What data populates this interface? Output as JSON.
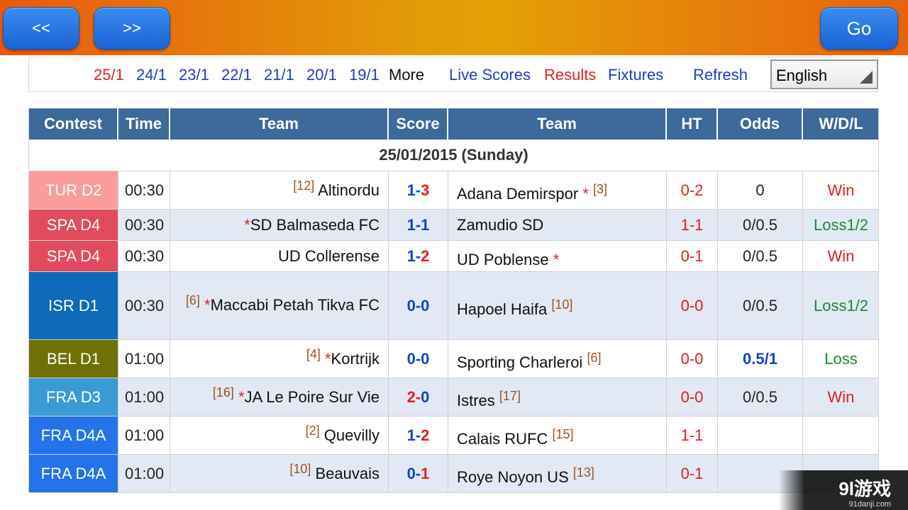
{
  "nav": {
    "prev_label": "<<",
    "next_label": ">>",
    "go_label": "Go"
  },
  "links": {
    "dates": [
      {
        "label": "25/1",
        "color": "#e02020"
      },
      {
        "label": "24/1",
        "color": "#1a3fbf"
      },
      {
        "label": "23/1",
        "color": "#1a3fbf"
      },
      {
        "label": "22/1",
        "color": "#1a3fbf"
      },
      {
        "label": "21/1",
        "color": "#1a3fbf"
      },
      {
        "label": "20/1",
        "color": "#1a3fbf"
      },
      {
        "label": "19/1",
        "color": "#1a3fbf"
      }
    ],
    "more": "More",
    "live": "Live Scores",
    "results": "Results",
    "fixtures": "Fixtures",
    "refresh": "Refresh",
    "language": "English"
  },
  "table": {
    "headers": [
      "Contest",
      "Time",
      "Team",
      "Score",
      "Team",
      "HT",
      "Odds",
      "W/D/L"
    ],
    "date_label": "25/01/2015 (Sunday)",
    "rows": [
      {
        "contest": "TUR D2",
        "contest_color": "#fb9c9c",
        "time": "00:30",
        "home_rank": "[12]",
        "home_star": "",
        "home": "Altinordu",
        "score_home": "1",
        "score_away": "3",
        "score_home_color": "#1144cc",
        "score_away_color": "#e02020",
        "away": "Adana Demirspor",
        "away_star": "*",
        "away_rank": "[3]",
        "ht": "0-2",
        "odds": "0",
        "odds_color": "#222222",
        "odds_bold": false,
        "wdl": "Win",
        "wdl_color": "#e02020"
      },
      {
        "contest": "SPA D4",
        "contest_color": "#e24b5d",
        "time": "00:30",
        "home_rank": "",
        "home_star": "*",
        "home": "SD Balmaseda FC",
        "score_home": "1",
        "score_away": "1",
        "score_home_color": "#1144cc",
        "score_away_color": "#1144cc",
        "away": "Zamudio SD",
        "away_star": "",
        "away_rank": "",
        "ht": "1-1",
        "odds": "0/0.5",
        "odds_color": "#222222",
        "odds_bold": false,
        "wdl": "Loss1/2",
        "wdl_color": "#1a8a2a"
      },
      {
        "contest": "SPA D4",
        "contest_color": "#e24b5d",
        "time": "00:30",
        "home_rank": "",
        "home_star": "",
        "home": "UD Collerense",
        "score_home": "1",
        "score_away": "2",
        "score_home_color": "#1144cc",
        "score_away_color": "#e02020",
        "away": "UD Poblense",
        "away_star": "*",
        "away_rank": "",
        "ht": "0-1",
        "odds": "0/0.5",
        "odds_color": "#222222",
        "odds_bold": false,
        "wdl": "Win",
        "wdl_color": "#e02020"
      },
      {
        "contest": "ISR D1",
        "contest_color": "#0f6ab8",
        "time": "00:30",
        "home_rank": "[6]",
        "home_star": "*",
        "home": "Maccabi Petah Tikva FC",
        "score_home": "0",
        "score_away": "0",
        "score_home_color": "#1144cc",
        "score_away_color": "#1144cc",
        "away": "Hapoel Haifa",
        "away_star": "",
        "away_rank": "[10]",
        "ht": "0-0",
        "odds": "0/0.5",
        "odds_color": "#222222",
        "odds_bold": false,
        "wdl": "Loss1/2",
        "wdl_color": "#1a8a2a"
      },
      {
        "contest": "BEL D1",
        "contest_color": "#6f7107",
        "time": "01:00",
        "home_rank": "[4]",
        "home_star": "*",
        "home": "Kortrijk",
        "score_home": "0",
        "score_away": "0",
        "score_home_color": "#1144cc",
        "score_away_color": "#1144cc",
        "away": "Sporting Charleroi",
        "away_star": "",
        "away_rank": "[6]",
        "ht": "0-0",
        "odds": "0.5/1",
        "odds_color": "#1144cc",
        "odds_bold": true,
        "wdl": "Loss",
        "wdl_color": "#1a8a2a"
      },
      {
        "contest": "FRA D3",
        "contest_color": "#3a9ad4",
        "time": "01:00",
        "home_rank": "[16]",
        "home_star": "*",
        "home": "JA Le Poire Sur Vie",
        "score_home": "2",
        "score_away": "0",
        "score_home_color": "#e02020",
        "score_away_color": "#1144cc",
        "away": "Istres",
        "away_star": "",
        "away_rank": "[17]",
        "ht": "0-0",
        "odds": "0/0.5",
        "odds_color": "#222222",
        "odds_bold": false,
        "wdl": "Win",
        "wdl_color": "#e02020"
      },
      {
        "contest": "FRA D4A",
        "contest_color": "#2573ea",
        "time": "01:00",
        "home_rank": "[2]",
        "home_star": "",
        "home": "Quevilly",
        "score_home": "1",
        "score_away": "2",
        "score_home_color": "#1144cc",
        "score_away_color": "#e02020",
        "away": "Calais RUFC",
        "away_star": "",
        "away_rank": "[15]",
        "ht": "1-1",
        "odds": "",
        "odds_color": "#222222",
        "odds_bold": false,
        "wdl": "",
        "wdl_color": "#222222"
      },
      {
        "contest": "FRA D4A",
        "contest_color": "#2573ea",
        "time": "01:00",
        "home_rank": "[10]",
        "home_star": "",
        "home": "Beauvais",
        "score_home": "0",
        "score_away": "1",
        "score_home_color": "#1144cc",
        "score_away_color": "#e02020",
        "away": "Roye Noyon US",
        "away_star": "",
        "away_rank": "[13]",
        "ht": "0-1",
        "odds": "",
        "odds_color": "#222222",
        "odds_bold": false,
        "wdl": "",
        "wdl_color": "#222222"
      }
    ]
  },
  "watermark": {
    "main": "9l游戏",
    "sub": "91danji.com"
  }
}
